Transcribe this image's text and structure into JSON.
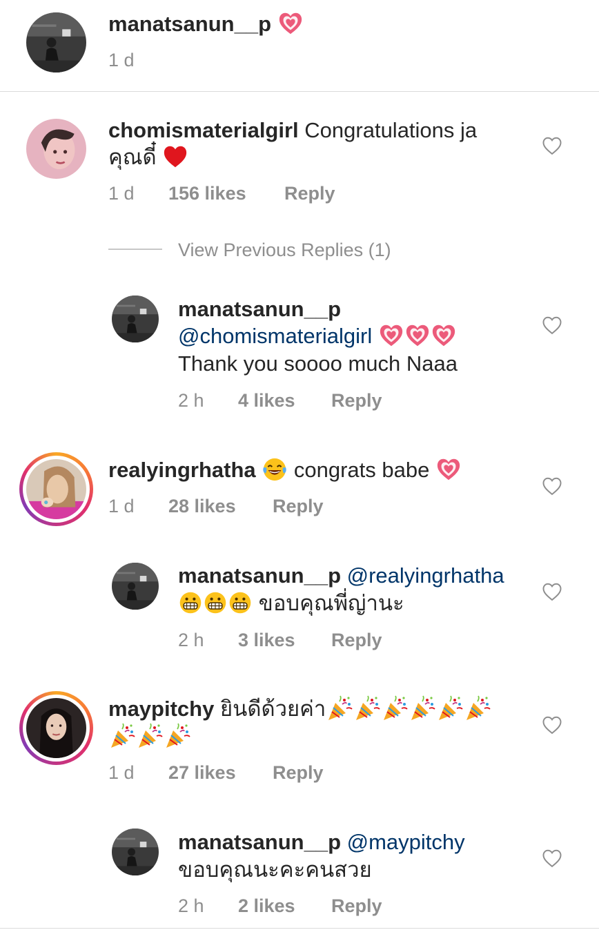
{
  "comments": [
    {
      "username": "manatsanun__p",
      "time": "1 d"
    },
    {
      "username": "chomismaterialgirl",
      "text_line1": "Congratulations ja",
      "text_line2": "คุณดี๋",
      "time": "1 d",
      "likes": "156 likes",
      "reply": "Reply"
    },
    {
      "view_previous": "View Previous Replies (1)"
    },
    {
      "username": "manatsanun__p",
      "mention": "@chomismaterialgirl",
      "text": "Thank you soooo much Naaa",
      "time": "2 h",
      "likes": "4 likes",
      "reply": "Reply"
    },
    {
      "username": "realyingrhatha",
      "text": "congrats babe",
      "time": "1 d",
      "likes": "28 likes",
      "reply": "Reply"
    },
    {
      "username": "manatsanun__p",
      "mention": "@realyingrhatha",
      "text": "ขอบคุณพี่ญ่านะ",
      "time": "2 h",
      "likes": "3 likes",
      "reply": "Reply"
    },
    {
      "username": "maypitchy",
      "text": "ยินดีด้วยค่า",
      "time": "1 d",
      "likes": "27 likes",
      "reply": "Reply"
    },
    {
      "username": "manatsanun__p",
      "mention": "@maypitchy",
      "text": "ขอบคุณนะคะคนสวย",
      "time": "2 h",
      "likes": "2 likes",
      "reply": "Reply"
    }
  ],
  "icons": {
    "like": "heart-outline-icon",
    "sparkle_heart": "sparkling-heart-emoji",
    "red_heart": "red-heart-emoji",
    "laugh": "tears-of-joy-emoji",
    "grimace": "grimacing-face-emoji",
    "party": "party-popper-emoji"
  },
  "colors": {
    "username": "#262626",
    "meta": "#8e8e8e",
    "mention": "#003569",
    "divider": "#dbdbdb",
    "heart_red": "#ed4956"
  }
}
